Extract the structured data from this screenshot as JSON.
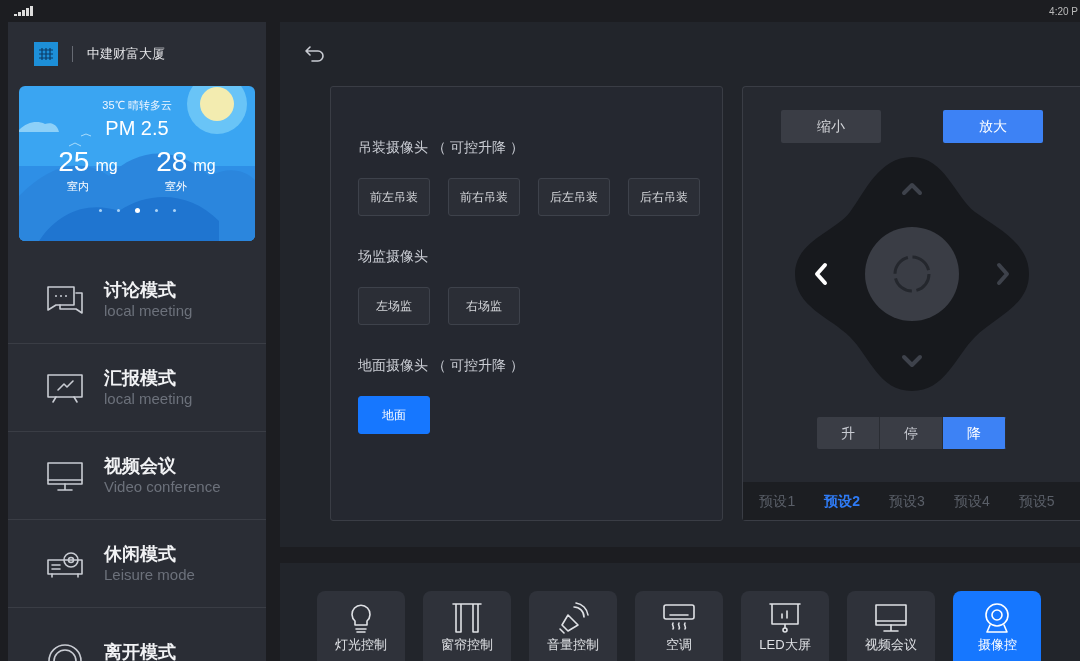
{
  "status_bar": {
    "time": "4:20 P"
  },
  "sidebar": {
    "building": "中建财富大厦",
    "weather": {
      "summary": "35℃  晴转多云",
      "title": "PM 2.5",
      "readings": [
        {
          "value": "25",
          "unit": "mg",
          "label": "室内"
        },
        {
          "value": "28",
          "unit": "mg",
          "label": "室外"
        }
      ],
      "page_dots": [
        {
          "selected": false
        },
        {
          "selected": false
        },
        {
          "selected": true
        },
        {
          "selected": false
        },
        {
          "selected": false
        }
      ]
    },
    "items": [
      {
        "title": "讨论模式",
        "subtitle": "local meeting"
      },
      {
        "title": "汇报模式",
        "subtitle": "local meeting"
      },
      {
        "title": "视频会议",
        "subtitle": "Video conference"
      },
      {
        "title": "休闲模式",
        "subtitle": "Leisure mode"
      },
      {
        "title": "离开模式"
      }
    ]
  },
  "cameras": [
    {
      "heading": "吊装摄像头 （ 可控升降 ）",
      "buttons": [
        {
          "label": "前左吊装",
          "selected": false
        },
        {
          "label": "前右吊装",
          "selected": false
        },
        {
          "label": "后左吊装",
          "selected": false
        },
        {
          "label": "后右吊装",
          "selected": false
        }
      ]
    },
    {
      "heading": "场监摄像头",
      "buttons": [
        {
          "label": "左场监",
          "selected": false
        },
        {
          "label": "右场监",
          "selected": false
        }
      ]
    },
    {
      "heading": "地面摄像头 （ 可控升降 ）",
      "buttons": [
        {
          "label": "地面",
          "selected": true
        }
      ]
    }
  ],
  "zoom_buttons": [
    {
      "label": "缩小",
      "selected": false
    },
    {
      "label": "放大",
      "selected": true
    }
  ],
  "dpad_arrows": [
    {
      "kind": "up",
      "selected": false
    },
    {
      "kind": "left",
      "selected": true
    },
    {
      "kind": "right",
      "selected": false
    },
    {
      "kind": "down",
      "selected": false
    }
  ],
  "lift_buttons": [
    {
      "label": "升",
      "selected": false
    },
    {
      "label": "停",
      "selected": false
    },
    {
      "label": "降",
      "selected": true
    }
  ],
  "presets": [
    {
      "label": "预设1",
      "selected": false
    },
    {
      "label": "预设2",
      "selected": true
    },
    {
      "label": "预设3",
      "selected": false
    },
    {
      "label": "预设4",
      "selected": false
    },
    {
      "label": "预设5",
      "selected": false
    }
  ],
  "bottom_tiles": [
    {
      "label": "灯光控制",
      "selected": false
    },
    {
      "label": "窗帘控制",
      "selected": false
    },
    {
      "label": "音量控制",
      "selected": false
    },
    {
      "label": "空调",
      "selected": false
    },
    {
      "label": "LED大屏",
      "selected": false
    },
    {
      "label": "视频会议",
      "selected": false
    },
    {
      "label": "摄像控",
      "selected": true
    }
  ]
}
